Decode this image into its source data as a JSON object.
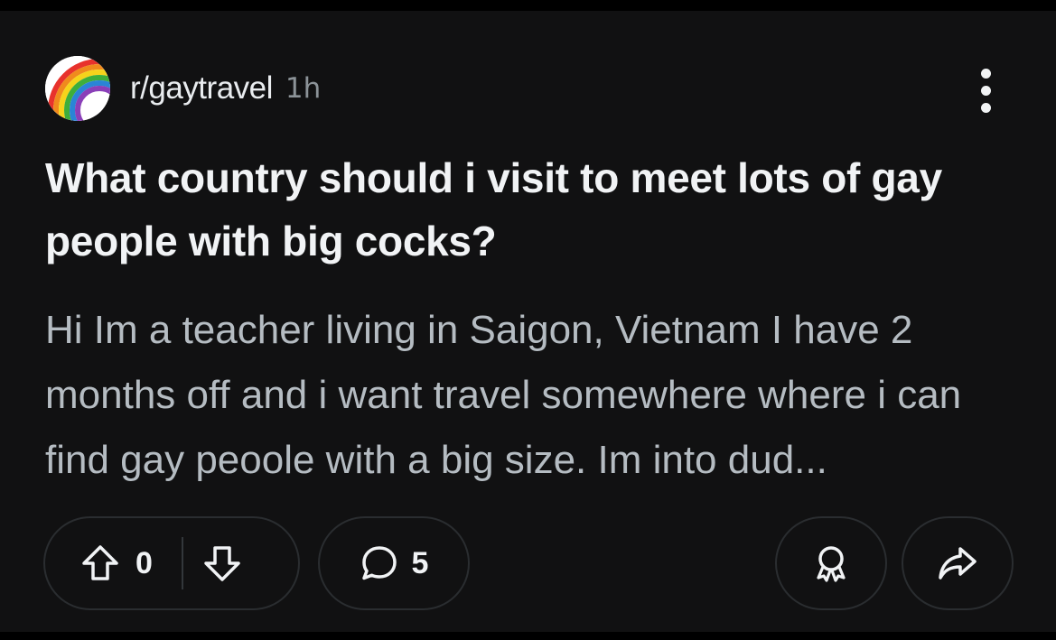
{
  "post": {
    "subreddit": "r/gaytravel",
    "age": "1h",
    "title": "What country should i visit to meet lots of gay people with big cocks?",
    "body": "Hi Im a teacher living in Saigon, Vietnam I have 2 months off and i want travel somewhere where i can find gay peoole with a big size. Im into dud..."
  },
  "actions": {
    "vote_count": "0",
    "comment_count": "5"
  },
  "icons": {
    "avatar": "rainbow-icon",
    "overflow": "more-vertical-icon",
    "upvote": "arrow-up-icon",
    "downvote": "arrow-down-icon",
    "comment": "speech-bubble-icon",
    "award": "award-icon",
    "share": "share-arrow-icon"
  },
  "colors": {
    "background": "#111112",
    "title": "#f1f3f5",
    "body": "#b5bcc2",
    "meta": "#8c9398",
    "pill_border": "#2a2d30"
  }
}
